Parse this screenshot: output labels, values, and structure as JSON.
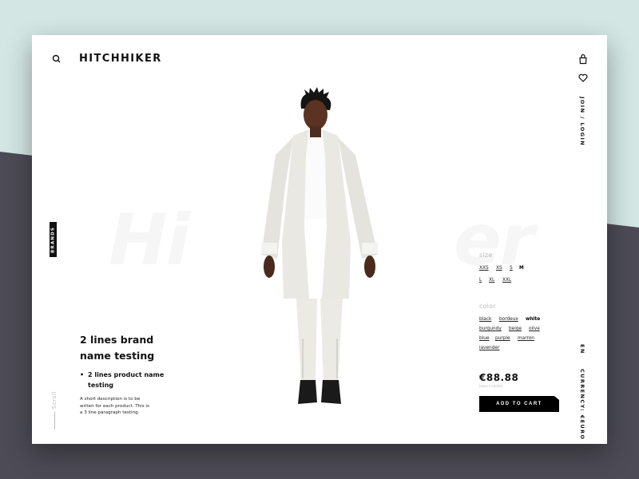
{
  "header": {
    "logo": "HITCHHIKER",
    "search_icon": "search-icon",
    "bag_icon": "shopping-bag-icon",
    "heart_icon": "heart-icon",
    "join_login": "JOIN / LOGIN"
  },
  "side": {
    "brands_tab": "BRANDS",
    "scroll_label": "Scroll",
    "language": "EN",
    "currency": "CURRENCY: €EURO"
  },
  "watermark": {
    "left": "Hi",
    "right": "er"
  },
  "product": {
    "brand_name": "2 lines brand name testing",
    "product_name": "2 lines product name testing",
    "description": "A short description is to be writen for each product. This is a 3 line paragraph testing.",
    "price": "€88.88",
    "taxes_note": "taxes included",
    "add_to_cart": "ADD TO CART"
  },
  "size": {
    "label": "size",
    "options": [
      "XXS",
      "XS",
      "S",
      "M",
      "L",
      "XL",
      "XXL"
    ],
    "selected": "M"
  },
  "color": {
    "label": "color",
    "options": [
      "black",
      "bordeux",
      "white",
      "burgundy",
      "beige",
      "olive",
      "blue",
      "purple",
      "marron",
      "lavender"
    ],
    "selected": "white"
  },
  "colors": {
    "background_top": "#d3e6e3",
    "background_bottom": "#4c4b56",
    "card": "#ffffff",
    "button": "#000000"
  }
}
